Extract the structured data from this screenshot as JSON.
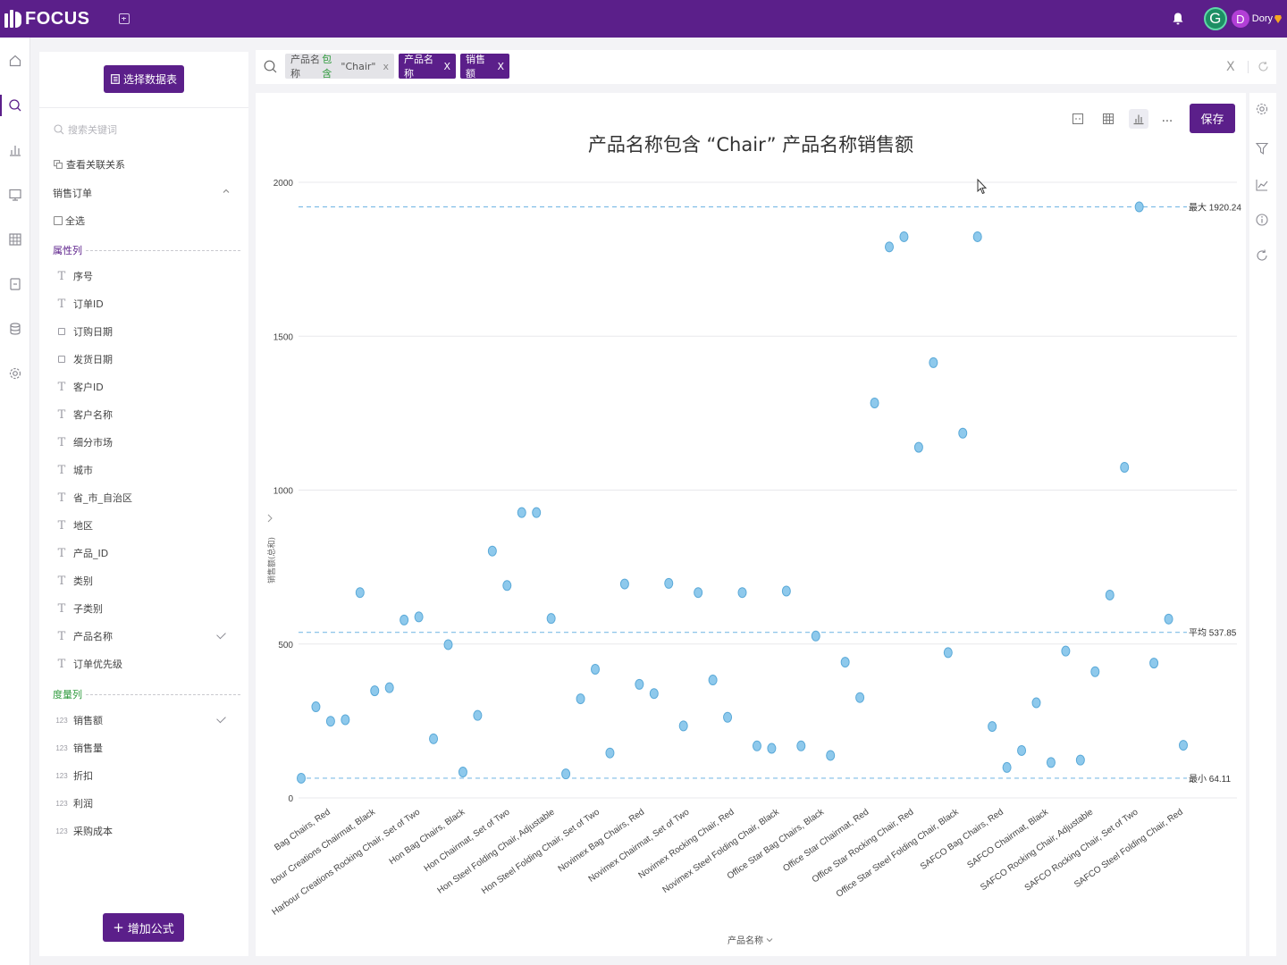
{
  "app": {
    "brand": "FOCUS",
    "user": {
      "avatar_letter": "G",
      "avatar2_letter": "D",
      "name": "Dory"
    },
    "colors": {
      "brand": "#5b1f8a",
      "dot": "#8ec9ec",
      "dot_stroke": "#5aa9d8",
      "refline": "#7fbde6",
      "keyword": "#2e9a3c"
    }
  },
  "rail": {
    "items": [
      {
        "name": "home-icon",
        "active": false
      },
      {
        "name": "search-icon",
        "active": true
      },
      {
        "name": "bar-chart-icon",
        "active": false
      },
      {
        "name": "dashboard-icon",
        "active": false
      },
      {
        "name": "table-icon",
        "active": false
      },
      {
        "name": "document-icon",
        "active": false
      },
      {
        "name": "database-icon",
        "active": false
      },
      {
        "name": "settings-icon",
        "active": false
      }
    ]
  },
  "fieldpanel": {
    "select_table_label": "选择数据表",
    "search_placeholder": "搜索关键词",
    "relation_label": "查看关联关系",
    "table_name": "销售订单",
    "select_all_label": "全选",
    "attributes_header": "属性列",
    "measures_header": "度量列",
    "attributes": [
      {
        "label": "序号",
        "icon": "T",
        "checked": false
      },
      {
        "label": "订单ID",
        "icon": "T",
        "checked": false
      },
      {
        "label": "订购日期",
        "icon": "cal",
        "checked": false
      },
      {
        "label": "发货日期",
        "icon": "cal",
        "checked": false
      },
      {
        "label": "客户ID",
        "icon": "T",
        "checked": false
      },
      {
        "label": "客户名称",
        "icon": "T",
        "checked": false
      },
      {
        "label": "细分市场",
        "icon": "T",
        "checked": false
      },
      {
        "label": "城市",
        "icon": "T",
        "checked": false
      },
      {
        "label": "省_市_自治区",
        "icon": "T",
        "checked": false
      },
      {
        "label": "地区",
        "icon": "T",
        "checked": false
      },
      {
        "label": "产品_ID",
        "icon": "T",
        "checked": false
      },
      {
        "label": "类别",
        "icon": "T",
        "checked": false
      },
      {
        "label": "子类别",
        "icon": "T",
        "checked": false
      },
      {
        "label": "产品名称",
        "icon": "T",
        "checked": true
      },
      {
        "label": "订单优先级",
        "icon": "T",
        "checked": false
      }
    ],
    "measures": [
      {
        "label": "销售额",
        "icon": "123",
        "checked": true
      },
      {
        "label": "销售量",
        "icon": "123",
        "checked": false
      },
      {
        "label": "折扣",
        "icon": "123",
        "checked": false
      },
      {
        "label": "利润",
        "icon": "123",
        "checked": false
      },
      {
        "label": "采购成本",
        "icon": "123",
        "checked": false
      }
    ],
    "add_formula_label": "增加公式"
  },
  "searchbar": {
    "chips": {
      "filter_field": "产品名称",
      "filter_keyword": "包含",
      "filter_value": "\"Chair\"",
      "dimension": "产品名称",
      "measure": "销售额",
      "close": "x",
      "close_upper": "X"
    },
    "clear_label": "X"
  },
  "toolbar": {
    "more_label": "...",
    "save_label": "保存"
  },
  "chart_data": {
    "type": "scatter",
    "title": "产品名称包含 “Chair” 产品名称销售额",
    "xlabel": "产品名称",
    "ylabel": "销售额(总和)",
    "ylim": [
      0,
      2000
    ],
    "yticks": [
      0,
      500,
      1000,
      1500,
      2000
    ],
    "reference_lines": [
      {
        "label": "最大 1920.24",
        "value": 1920.24
      },
      {
        "label": "平均 537.85",
        "value": 537.85
      },
      {
        "label": "最小 64.11",
        "value": 64.11
      }
    ],
    "x_tick_labels": [
      "Harbour Creations Bag Chairs, Red",
      "Harbour Creations Chairmat, Black",
      "Harbour Creations Rocking Chair, Set of Two",
      "Hon Bag Chairs, Black",
      "Hon Chairmat, Set of Two",
      "Hon Steel Folding Chair, Adjustable",
      "Hon Steel Folding Chair, Set of Two",
      "Novimex Bag Chairs, Red",
      "Novimex Chairmat, Set of Two",
      "Novimex Rocking Chair, Red",
      "Novimex Steel Folding Chair, Black",
      "Office Star Bag Chairs, Black",
      "Office Star Chairmat, Red",
      "Office Star Rocking Chair, Red",
      "Office Star Steel Folding Chair, Black",
      "SAFCO Bag Chairs, Red",
      "SAFCO Chairmat, Black",
      "SAFCO Rocking Chair, Adjustable",
      "SAFCO Rocking Chair, Set of Two",
      "SAFCO Steel Folding Chair, Red"
    ],
    "x_tick_visible": [
      "Bag Chairs, Red",
      "bour Creations Chairmat, Black",
      "Harbour Creations Rocking Chair, Set of Two",
      "Hon Bag Chairs, Black",
      "Hon Chairmat, Set of Two",
      "Hon Steel Folding Chair, Adjustable",
      "Hon Steel Folding Chair, Set of Two",
      "Novimex Bag Chairs, Red",
      "Novimex Chairmat, Set of Two",
      "Novimex Rocking Chair, Red",
      "Novimex Steel Folding Chair, Black",
      "Office Star Bag Chairs, Black",
      "Office Star Chairmat, Red",
      "Office Star Rocking Chair, Red",
      "Office Star Steel Folding Chair, Black",
      "SAFCO Bag Chairs, Red",
      "SAFCO Chairmat, Black",
      "SAFCO Rocking Chair, Adjustable",
      "SAFCO Rocking Chair, Set of Two",
      "SAFCO Steel Folding Chair, Red"
    ],
    "values": [
      64,
      296,
      249,
      254,
      667,
      348,
      358,
      578,
      588,
      192,
      498,
      84,
      268,
      802,
      690,
      927,
      927,
      583,
      78,
      322,
      418,
      146,
      695,
      369,
      339,
      697,
      234,
      667,
      383,
      262,
      667,
      169,
      161,
      672,
      169,
      526,
      138,
      441,
      326,
      1283,
      1790,
      1823,
      1139,
      1414,
      472,
      1185,
      1823,
      232,
      99,
      154,
      309,
      115,
      477,
      123,
      410,
      659,
      1074,
      1920,
      438,
      581,
      171
    ]
  }
}
